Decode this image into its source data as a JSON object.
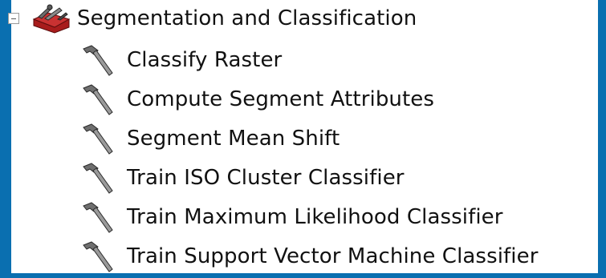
{
  "toolbox": {
    "label": "Segmentation and Classification",
    "icon": "toolbox-icon",
    "expanded": true
  },
  "tools": [
    {
      "label": "Classify Raster",
      "icon": "hammer-icon"
    },
    {
      "label": "Compute Segment Attributes",
      "icon": "hammer-icon"
    },
    {
      "label": "Segment Mean Shift",
      "icon": "hammer-icon"
    },
    {
      "label": "Train ISO Cluster Classifier",
      "icon": "hammer-icon"
    },
    {
      "label": "Train Maximum Likelihood Classifier",
      "icon": "hammer-icon"
    },
    {
      "label": "Train Support Vector Machine Classifier",
      "icon": "hammer-icon"
    }
  ],
  "colors": {
    "frame": "#0a6fb0",
    "panel": "#ffffff",
    "text": "#111111",
    "toolbox_red": "#b01e1e"
  }
}
